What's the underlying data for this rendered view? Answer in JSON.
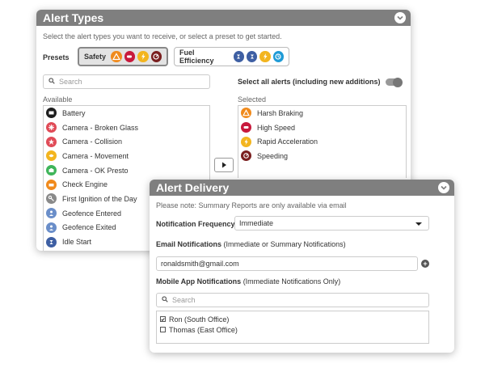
{
  "alert_types": {
    "title": "Alert Types",
    "intro": "Select the alert types you want to receive, or select a preset to get started.",
    "presets_label": "Presets",
    "presets": [
      {
        "label": "Safety",
        "icons": [
          "harsh-braking-icon",
          "high-speed-icon",
          "rapid-acceleration-icon",
          "speeding-icon"
        ]
      },
      {
        "label": "Fuel Efficiency",
        "icons": [
          "idle-icon",
          "idle-icon",
          "rapid-acceleration-icon",
          "clock-icon"
        ]
      }
    ],
    "search_placeholder": "Search",
    "available_label": "Available",
    "available": [
      {
        "label": "Battery",
        "icon": "battery-icon",
        "color": "#1e1e1e"
      },
      {
        "label": "Camera - Broken Glass",
        "icon": "broken-glass-icon",
        "color": "#e04b57"
      },
      {
        "label": "Camera - Collision",
        "icon": "collision-icon",
        "color": "#e04b57"
      },
      {
        "label": "Camera - Movement",
        "icon": "movement-icon",
        "color": "#f3b51f"
      },
      {
        "label": "Camera - OK Presto",
        "icon": "camera-icon",
        "color": "#3fb55a"
      },
      {
        "label": "Check Engine",
        "icon": "engine-icon",
        "color": "#f08a1c"
      },
      {
        "label": "First Ignition of the Day",
        "icon": "key-icon",
        "color": "#8a8a8a"
      },
      {
        "label": "Geofence Entered",
        "icon": "geofence-icon",
        "color": "#6a8ec9"
      },
      {
        "label": "Geofence Exited",
        "icon": "geofence-icon",
        "color": "#6a8ec9"
      },
      {
        "label": "Idle Start",
        "icon": "idle-icon",
        "color": "#3e5fa3"
      }
    ],
    "select_all_label": "Select all alerts (including new additions)",
    "select_all_on": false,
    "selected_label": "Selected",
    "selected": [
      {
        "label": "Harsh Braking",
        "icon": "harsh-braking-icon",
        "color": "#f08a1c"
      },
      {
        "label": "High Speed",
        "icon": "high-speed-icon",
        "color": "#c8193c"
      },
      {
        "label": "Rapid Acceleration",
        "icon": "rapid-acceleration-icon",
        "color": "#f3b51f"
      },
      {
        "label": "Speeding",
        "icon": "speeding-icon",
        "color": "#7a1f1f"
      }
    ]
  },
  "alert_delivery": {
    "title": "Alert Delivery",
    "note": "Please note: Summary Reports are only available via email",
    "frequency_label": "Notification Frequency",
    "frequency_value": "Immediate",
    "email_label": "Email Notifications",
    "email_hint": "(Immediate or Summary Notifications)",
    "email_value": "ronaldsmith@gmail.com",
    "mobile_label": "Mobile App Notifications",
    "mobile_hint": "(Immediate Notifications Only)",
    "mobile_search_placeholder": "Search",
    "recipients": [
      {
        "label": "Ron (South Office)",
        "checked": true
      },
      {
        "label": "Thomas (East Office)",
        "checked": false
      }
    ]
  }
}
